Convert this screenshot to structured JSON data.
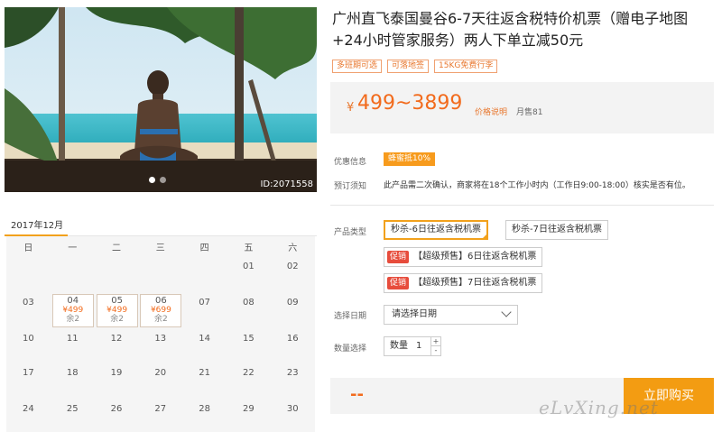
{
  "product": {
    "title": "广州直飞泰国曼谷6-7天往返含税特价机票（赠电子地图+24小时管家服务）两人下单立减50元",
    "tags": [
      "多班期可选",
      "可落地签",
      "15KG免费行李"
    ],
    "image_id": "ID:2071558"
  },
  "price": {
    "currency": "¥",
    "range": "499~3899",
    "note": "价格说明",
    "monthly_sales": "月售81"
  },
  "info": {
    "discount_label": "优惠信息",
    "discount_badge": "蜂蜜抵10%",
    "booking_label": "预订须知",
    "booking_text": "此产品需二次确认，商家将在18个工作小时内（工作日9:00-18:00）核实是否有位。"
  },
  "product_type": {
    "label": "产品类型",
    "options": [
      "秒杀-6日往返含税机票",
      "秒杀-7日往返含税机票"
    ],
    "promo_tag": "促销",
    "promos": [
      "【超级预售】6日往返含税机票",
      "【超级预售】7日往返含税机票"
    ]
  },
  "date": {
    "label": "选择日期",
    "placeholder": "请选择日期"
  },
  "quantity": {
    "label": "数量选择",
    "field_label": "数量",
    "value": "1",
    "up": "+",
    "down": "-"
  },
  "purchase": {
    "total": "--",
    "buy_label": "立即购买"
  },
  "calendar": {
    "month": "2017年12月",
    "weekdays": [
      "日",
      "一",
      "二",
      "三",
      "四",
      "五",
      "六"
    ],
    "rows": [
      [
        "",
        "",
        "",
        "",
        "",
        "01",
        "02"
      ],
      [
        "03",
        "04",
        "05",
        "06",
        "07",
        "08",
        "09"
      ],
      [
        "10",
        "11",
        "12",
        "13",
        "14",
        "15",
        "16"
      ],
      [
        "17",
        "18",
        "19",
        "20",
        "21",
        "22",
        "23"
      ],
      [
        "24",
        "25",
        "26",
        "27",
        "28",
        "29",
        "30"
      ]
    ],
    "priced_days": [
      {
        "day": "04",
        "price": "¥499",
        "stock": "余2"
      },
      {
        "day": "05",
        "price": "¥499",
        "stock": "余2"
      },
      {
        "day": "06",
        "price": "¥699",
        "stock": "余2"
      }
    ]
  },
  "watermark": "eLvXing.net",
  "colors": {
    "accent": "#f39c12",
    "price": "#f26b1d",
    "promo": "#e74c3c"
  }
}
